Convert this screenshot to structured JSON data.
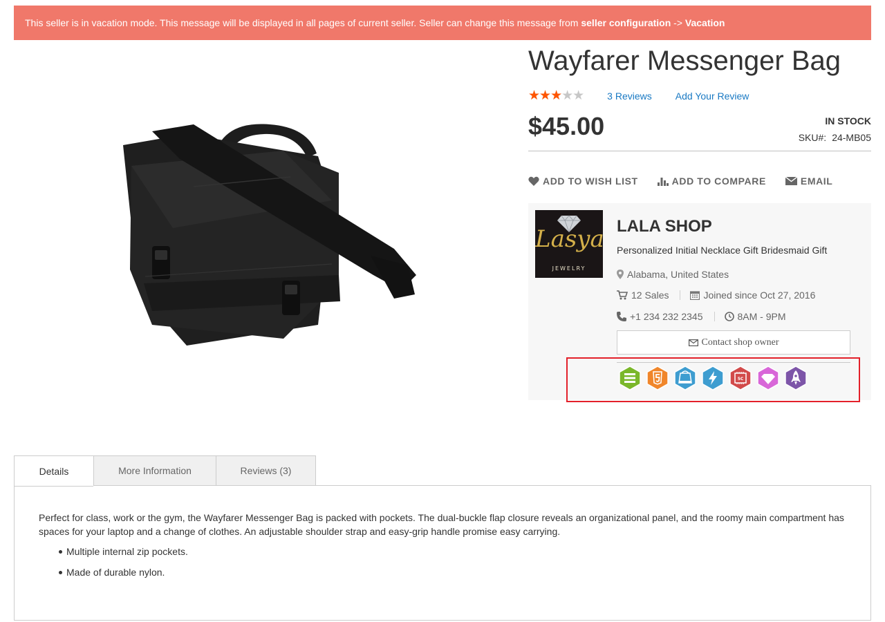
{
  "vacation_banner": {
    "message": "This seller is in vacation mode. This message will be displayed in all pages of current seller. Seller can change this message from ",
    "link1": "seller configuration",
    "arrow": " -> ",
    "link2": "Vacation"
  },
  "product": {
    "title": "Wayfarer Messenger Bag",
    "rating_fraction": 0.6,
    "reviews_label": "3 Reviews",
    "add_review_label": "Add Your Review",
    "price": "$45.00",
    "stock": "In stock",
    "sku_label": "SKU#:",
    "sku": "24-MB05"
  },
  "actions": {
    "wishlist": "Add to Wish List",
    "compare": "Add to Compare",
    "email": "Email"
  },
  "seller": {
    "logo_text": "Lasya",
    "logo_subtext": "JEWELRY",
    "name": "LALA SHOP",
    "tagline": "Personalized Initial Necklace Gift Bridesmaid Gift",
    "location": "Alabama, United States",
    "sales": "12 Sales",
    "joined": "Joined since Oct 27, 2016",
    "phone": "+1 234 232 2345",
    "hours": "8AM - 9PM",
    "contact_label": "Contact shop owner"
  },
  "badges": [
    {
      "icon": "stack-badge-icon",
      "color": "#7ab72a"
    },
    {
      "icon": "html5-badge-icon",
      "color": "#f0862b"
    },
    {
      "icon": "cart-badge-icon",
      "color": "#3e9dd0"
    },
    {
      "icon": "lightning-badge-icon",
      "color": "#3e9dd0"
    },
    {
      "icon": "chip-badge-icon",
      "color": "#d24a4a"
    },
    {
      "icon": "diamond-badge-icon",
      "color": "#d867d8"
    },
    {
      "icon": "rocket-badge-icon",
      "color": "#7d55a8"
    }
  ],
  "tabs": [
    {
      "label": "Details"
    },
    {
      "label": "More Information"
    },
    {
      "label": "Reviews (3)"
    }
  ],
  "details": {
    "description": "Perfect for class, work or the gym, the Wayfarer Messenger Bag is packed with pockets. The dual-buckle flap closure reveals an organizational panel, and the roomy main compartment has spaces for your laptop and a change of clothes. An adjustable shoulder strap and easy-grip handle promise easy carrying.",
    "bullets": [
      "Multiple internal zip pockets.",
      "Made of durable nylon."
    ]
  },
  "colors": {
    "banner": "#f0786a",
    "link": "#1979c3",
    "star": "#ff5501",
    "highlight": "#e3202a"
  }
}
